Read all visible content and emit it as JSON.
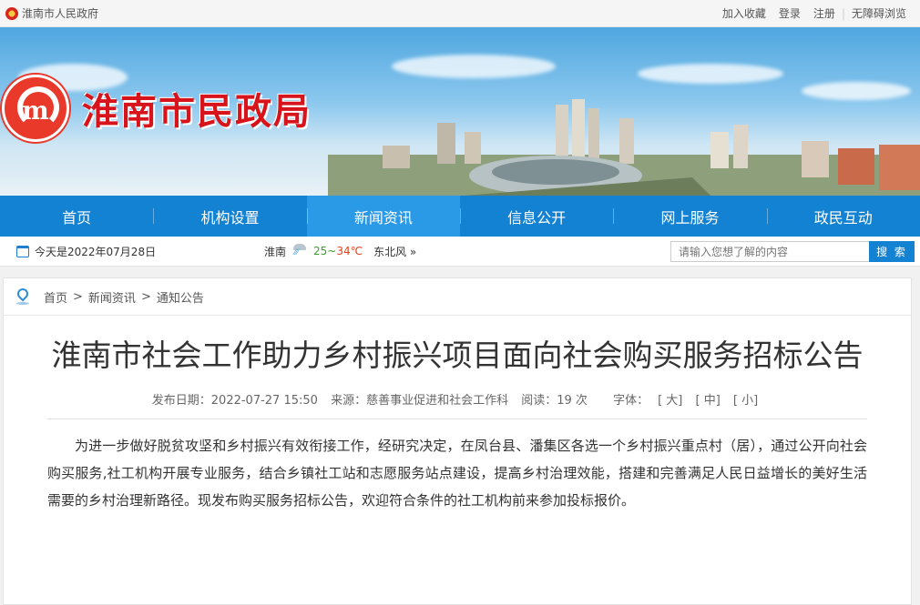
{
  "topbar": {
    "site_name": "淮南市人民政府",
    "links": [
      "加入收藏",
      "登录",
      "注册",
      "无障碍浏览"
    ]
  },
  "banner": {
    "title": "淮南市民政局"
  },
  "nav": {
    "items": [
      {
        "label": "首页"
      },
      {
        "label": "机构设置"
      },
      {
        "label": "新闻资讯"
      },
      {
        "label": "信息公开"
      },
      {
        "label": "网上服务"
      },
      {
        "label": "政民互动"
      }
    ],
    "active_index": 2
  },
  "infobar": {
    "date": "今天是2022年07月28日",
    "city": "淮南",
    "temp_low": "25",
    "temp_sep": "~",
    "temp_high": "34℃",
    "wind": "东北风 »",
    "search_placeholder": "请输入您想了解的内容",
    "search_button": "搜 索"
  },
  "breadcrumb": {
    "items": [
      "首页",
      "新闻资讯",
      "通知公告"
    ],
    "separator": ">"
  },
  "article": {
    "title": "淮南市社会工作助力乡村振兴项目面向社会购买服务招标公告",
    "meta": {
      "date": "发布日期：2022-07-27 15:50",
      "source": "来源：慈善事业促进和社会工作科",
      "views": "阅读：19 次",
      "font_label": "字体：",
      "sizes": [
        "[ 大]",
        "[ 中]",
        "[ 小]"
      ]
    },
    "paragraph": "为进一步做好脱贫攻坚和乡村振兴有效衔接工作，经研究决定，在凤台县、潘集区各选一个乡村振兴重点村（居），通过公开向社会购买服务,社工机构开展专业服务，结合乡镇社工站和志愿服务站点建设，提高乡村治理效能，搭建和完善满足人民日益增长的美好生活需要的乡村治理新路径。现发布购买服务招标公告，欢迎符合条件的社工机构前来参加投标报价。"
  },
  "colors": {
    "nav_bg": "#1482d2",
    "nav_active": "#2b9ae6",
    "title_red": "#d7141b"
  }
}
